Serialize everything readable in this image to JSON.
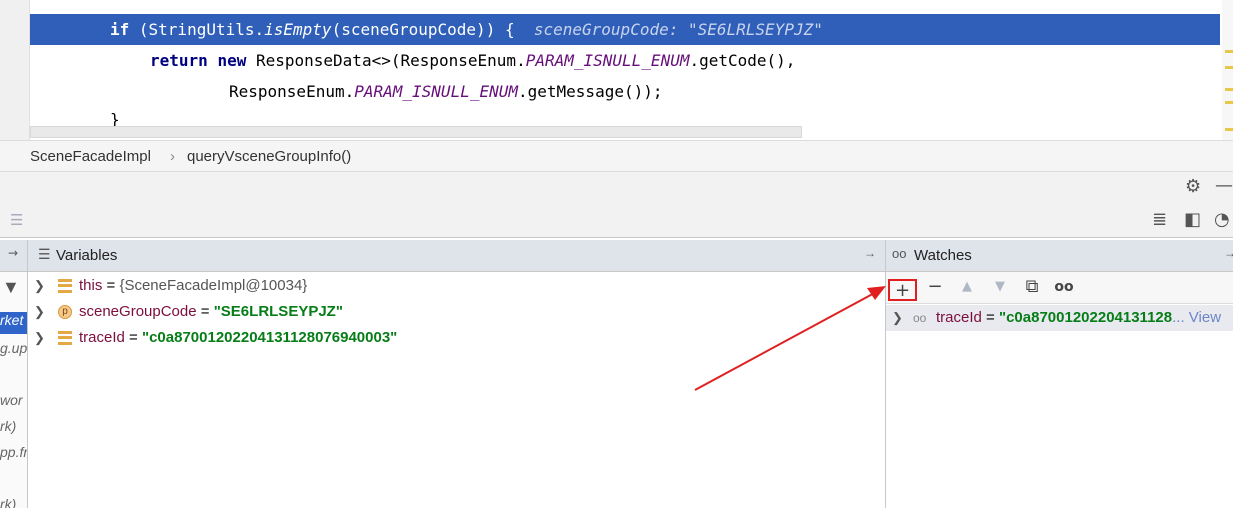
{
  "editor": {
    "line1": {
      "kw_if": "if",
      "open": " (StringUtils.",
      "method": "isEmpty",
      "args": "(sceneGroupCode)) {",
      "hint": "sceneGroupCode: \"SE6LRLSEYPJZ\""
    },
    "line2": {
      "kw_return": "return",
      "kw_new": "new",
      "text1": " ResponseData<>(ResponseEnum.",
      "const1": "PARAM_ISNULL_ENUM",
      "text2": ".getCode(),"
    },
    "line3": {
      "text1": "ResponseEnum.",
      "const1": "PARAM_ISNULL_ENUM",
      "text2": ".getMessage());"
    },
    "line4": "}"
  },
  "breadcrumb": {
    "class": "SceneFacadeImpl",
    "sep": "›",
    "method": "queryVsceneGroupInfo()"
  },
  "frames": {
    "items": [
      "rket",
      "g.up",
      "wor",
      "rk)",
      "pp.fr",
      "rk)"
    ]
  },
  "variables": {
    "title": "Variables",
    "rows": [
      {
        "name": "this",
        "eq": " = ",
        "value": "{SceneFacadeImpl@10034}",
        "kind": "object"
      },
      {
        "name": "sceneGroupCode",
        "eq": " = ",
        "value": "\"SE6LRLSEYPJZ\"",
        "kind": "param"
      },
      {
        "name": "traceId",
        "eq": " = ",
        "value": "\"c0a87001202204131128076940003\"",
        "kind": "object"
      }
    ]
  },
  "watches": {
    "title": "Watches",
    "toolbar": {
      "add": "+",
      "remove": "−",
      "up": "▲",
      "down": "▼",
      "copy": "⧉",
      "glasses": "oo"
    },
    "rows": [
      {
        "name": "traceId",
        "eq": " = ",
        "value": "\"c0a87001202204131128",
        "view": "... View"
      }
    ]
  },
  "colors": {
    "selection": "#2f5fb8",
    "annotation": "#e02020",
    "string": "#067d17"
  }
}
